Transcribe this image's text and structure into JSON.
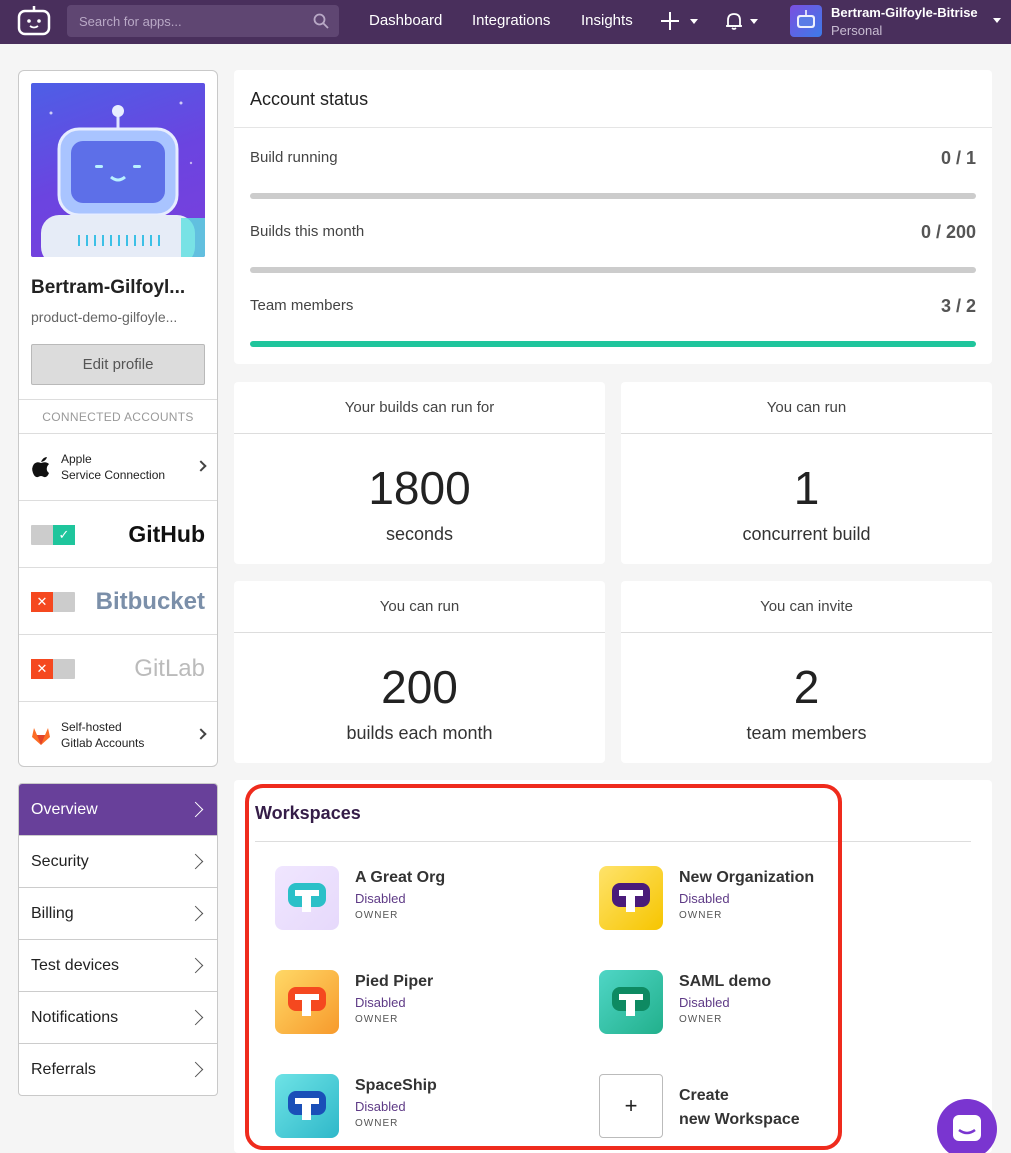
{
  "topbar": {
    "search_placeholder": "Search for apps...",
    "nav": [
      "Dashboard",
      "Integrations",
      "Insights"
    ],
    "plus_label": "+",
    "user_name": "Bertram-Gilfoyle-Bitrise",
    "user_sub": "Personal",
    "icons": [
      "bitrise-logo-icon",
      "search-icon",
      "plus-icon",
      "bell-icon",
      "chevron-down-icon"
    ]
  },
  "profile": {
    "name": "Bertram-Gilfoyl...",
    "email": "product-demo-gilfoyle...",
    "edit_label": "Edit profile",
    "connected_header": "CONNECTED ACCOUNTS",
    "apple_line1": "Apple",
    "apple_line2": "Service Connection",
    "github": "GitHub",
    "bitbucket": "Bitbucket",
    "gitlab": "GitLab",
    "selfhosted_line1": "Self-hosted",
    "selfhosted_line2": "Gitlab Accounts",
    "github_connected": true,
    "bitbucket_connected": false,
    "gitlab_connected": false
  },
  "menu": {
    "items": [
      "Overview",
      "Security",
      "Billing",
      "Test devices",
      "Notifications",
      "Referrals"
    ],
    "active": "Overview"
  },
  "account_status": {
    "title": "Account status",
    "rows": [
      {
        "label": "Build running",
        "value": "0 / 1",
        "fraction": 0
      },
      {
        "label": "Builds this month",
        "value": "0 / 200",
        "fraction": 0
      },
      {
        "label": "Team members",
        "value": "3 / 2",
        "fraction": 1
      }
    ]
  },
  "tiles": [
    {
      "head": "Your builds can run for",
      "number": "1800",
      "unit": "seconds"
    },
    {
      "head": "You can run",
      "number": "1",
      "unit": "concurrent build"
    },
    {
      "head": "You can run",
      "number": "200",
      "unit": "builds each month"
    },
    {
      "head": "You can invite",
      "number": "2",
      "unit": "team members"
    }
  ],
  "workspaces": {
    "title": "Workspaces",
    "items": [
      {
        "name": "A Great Org",
        "status": "Disabled",
        "role": "OWNER"
      },
      {
        "name": "New Organization",
        "status": "Disabled",
        "role": "OWNER"
      },
      {
        "name": "Pied Piper",
        "status": "Disabled",
        "role": "OWNER"
      },
      {
        "name": "SAML demo",
        "status": "Disabled",
        "role": "OWNER"
      },
      {
        "name": "SpaceShip",
        "status": "Disabled",
        "role": "OWNER"
      }
    ],
    "create_line1": "Create",
    "create_line2": "new Workspace",
    "create_plus": "+"
  },
  "colors": {
    "topbar": "#492f5c",
    "accent_purple": "#68409a",
    "progress_green": "#1fc59c",
    "highlight_red": "#ef2b1d"
  }
}
